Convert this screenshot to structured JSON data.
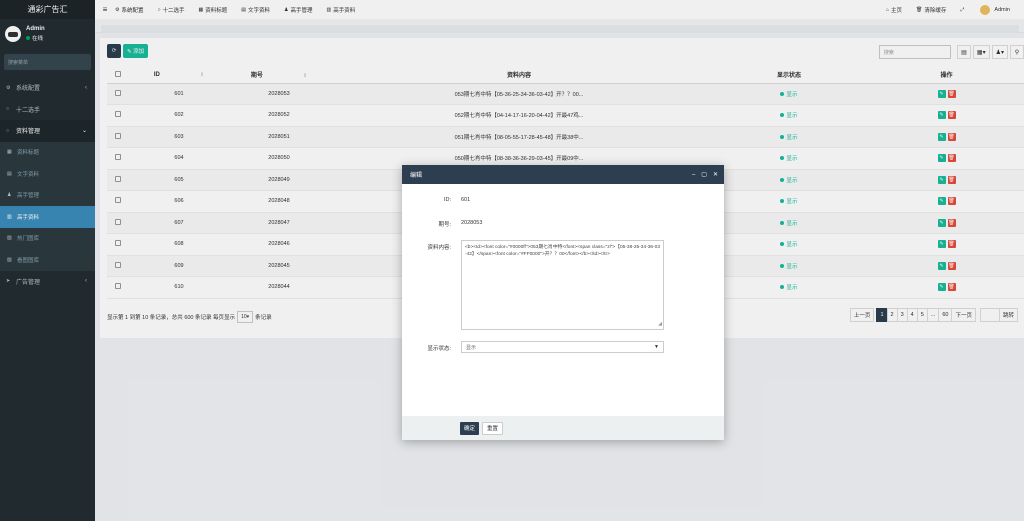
{
  "app": {
    "logo": "通彩广告汇"
  },
  "user": {
    "name": "Admin",
    "status": "在线"
  },
  "sidebar": {
    "search_placeholder": "搜索菜单",
    "items": [
      {
        "label": "系统配置",
        "icon": "gears-icon",
        "chevron": "‹"
      },
      {
        "label": "十二选手",
        "icon": "circle-icon"
      },
      {
        "label": "资料管理",
        "icon": "circle-icon",
        "chevron": "⌄"
      },
      {
        "label": "资料标题",
        "icon": "list-icon"
      },
      {
        "label": "文字资料",
        "icon": "file-icon"
      },
      {
        "label": "高手管理",
        "icon": "user-icon"
      },
      {
        "label": "高手资料",
        "icon": "book-icon"
      },
      {
        "label": "热门图库",
        "icon": "image-icon"
      },
      {
        "label": "看图图库",
        "icon": "image-icon"
      },
      {
        "label": "广告管理",
        "icon": "send-icon",
        "chevron": "‹"
      }
    ]
  },
  "topnav": {
    "menu_icon": "≡",
    "items": [
      {
        "label": "系统配置",
        "icon": "⚙"
      },
      {
        "label": "十二选手",
        "icon": "○"
      },
      {
        "label": "资料标题",
        "icon": "▦"
      },
      {
        "label": "文字资料",
        "icon": "▤"
      },
      {
        "label": "高手管理",
        "icon": "♟"
      },
      {
        "label": "高手资料",
        "icon": "▥"
      }
    ],
    "right": [
      {
        "label": "主页",
        "icon": "⌂"
      },
      {
        "label": "清除缓存",
        "icon": "🗑"
      },
      {
        "label": "",
        "icon": "⤢"
      },
      {
        "label": "Admin",
        "icon": ""
      }
    ]
  },
  "toolbar": {
    "refresh_icon": "⟳",
    "add_label": "✎ 添加",
    "search_placeholder": "搜索",
    "tools": [
      "▤",
      "▦▾",
      "♟▾",
      "⚲"
    ]
  },
  "table": {
    "headers": [
      "ID",
      "期号",
      "资料内容",
      "显示状态",
      "操作"
    ],
    "rows": [
      {
        "id": "601",
        "issue": "2028053",
        "content": "053期七肖中特【05-36-25-34-36-03-42】开？？00...",
        "status": "显示"
      },
      {
        "id": "602",
        "issue": "2028052",
        "content": "052期七肖中特【04-14-17-16-20-04-42】开最47鸡...",
        "status": "显示"
      },
      {
        "id": "603",
        "issue": "2028051",
        "content": "051期七肖中特【08-05-55-17-28-45-48】开最38中...",
        "status": "显示"
      },
      {
        "id": "604",
        "issue": "2028050",
        "content": "050期七肖中特【08-38-36-36-29-03-45】开最09中...",
        "status": "显示"
      },
      {
        "id": "605",
        "issue": "2028049",
        "content": "",
        "status": "显示"
      },
      {
        "id": "606",
        "issue": "2028048",
        "content": "",
        "status": "显示"
      },
      {
        "id": "607",
        "issue": "2028047",
        "content": "",
        "status": "显示"
      },
      {
        "id": "608",
        "issue": "2028046",
        "content": "",
        "status": "显示"
      },
      {
        "id": "609",
        "issue": "2028045",
        "content": "",
        "status": "显示"
      },
      {
        "id": "610",
        "issue": "2028044",
        "content": "",
        "status": "显示"
      }
    ]
  },
  "pagination": {
    "info_prefix": "显示第 1 到第 10 条记录，总共 600 条记录 每页显示",
    "page_size": "10▾",
    "info_suffix": "条记录",
    "prev": "上一页",
    "pages": [
      "1",
      "2",
      "3",
      "4",
      "5",
      "...",
      "60"
    ],
    "next": "下一页",
    "goto": "跳转"
  },
  "modal": {
    "title": "编辑",
    "controls": [
      "–",
      "▢",
      "✕"
    ],
    "id_label": "ID:",
    "id_value": "601",
    "issue_label": "期号:",
    "issue_value": "2028053",
    "content_label": "资料内容:",
    "content_value": "<b><td><font color=\"#0000ff\">053期七肖中特</font><span class=\"zl\">【05-36-25-34-36-03-42】</span><font color=\"#FF0000\">开？？00</font></b></td></tr>",
    "status_label": "显示状态:",
    "status_value": "显示",
    "ok": "确定",
    "reset": "重置"
  }
}
